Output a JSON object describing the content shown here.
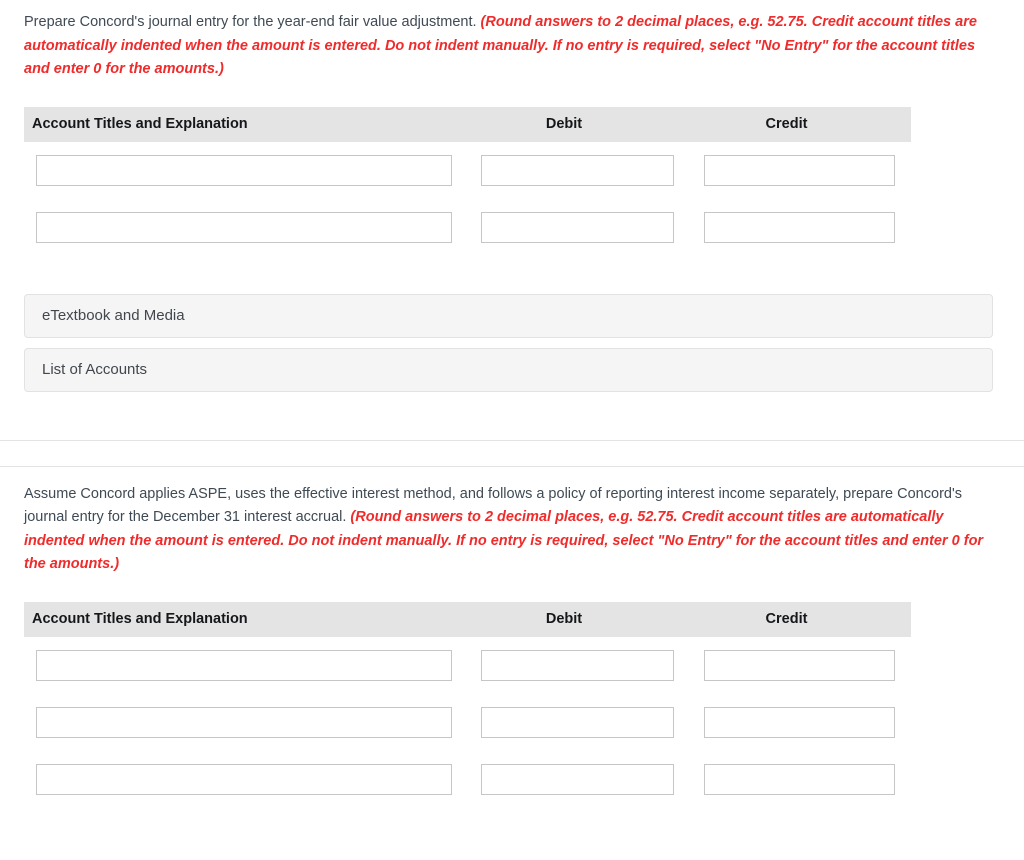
{
  "block_one": {
    "prompt_plain": "Prepare Concord's journal entry for the year-end fair value adjustment. ",
    "prompt_emphasis": "(Round answers to 2 decimal places, e.g. 52.75. Credit account titles are automatically indented when the amount is entered. Do not indent manually. If no entry is required, select \"No Entry\" for the account titles and enter 0 for the amounts.)",
    "table": {
      "headers": {
        "account": "Account Titles and Explanation",
        "debit": "Debit",
        "credit": "Credit"
      },
      "rows": [
        {
          "account": "",
          "debit": "",
          "credit": ""
        },
        {
          "account": "",
          "debit": "",
          "credit": ""
        }
      ]
    },
    "panels": [
      {
        "label": "eTextbook and Media"
      },
      {
        "label": "List of Accounts"
      }
    ]
  },
  "block_two": {
    "prompt_plain": "Assume Concord applies ASPE, uses the effective interest method, and follows a policy of reporting interest income separately, prepare Concord's journal entry for the December 31 interest accrual. ",
    "prompt_emphasis": "(Round answers to 2 decimal places, e.g. 52.75. Credit account titles are automatically indented when the amount is entered. Do not indent manually. If no entry is required, select \"No Entry\" for the account titles and enter 0 for the amounts.)",
    "table": {
      "headers": {
        "account": "Account Titles and Explanation",
        "debit": "Debit",
        "credit": "Credit"
      },
      "rows": [
        {
          "account": "",
          "debit": "",
          "credit": ""
        },
        {
          "account": "",
          "debit": "",
          "credit": ""
        },
        {
          "account": "",
          "debit": "",
          "credit": ""
        }
      ]
    }
  },
  "colors": {
    "emphasis_red": "#ef2b2b",
    "body_text": "#3f4a54",
    "table_header_bg": "#e4e4e4",
    "panel_bg": "#f5f5f5",
    "field_border": "#c6c6c6"
  }
}
